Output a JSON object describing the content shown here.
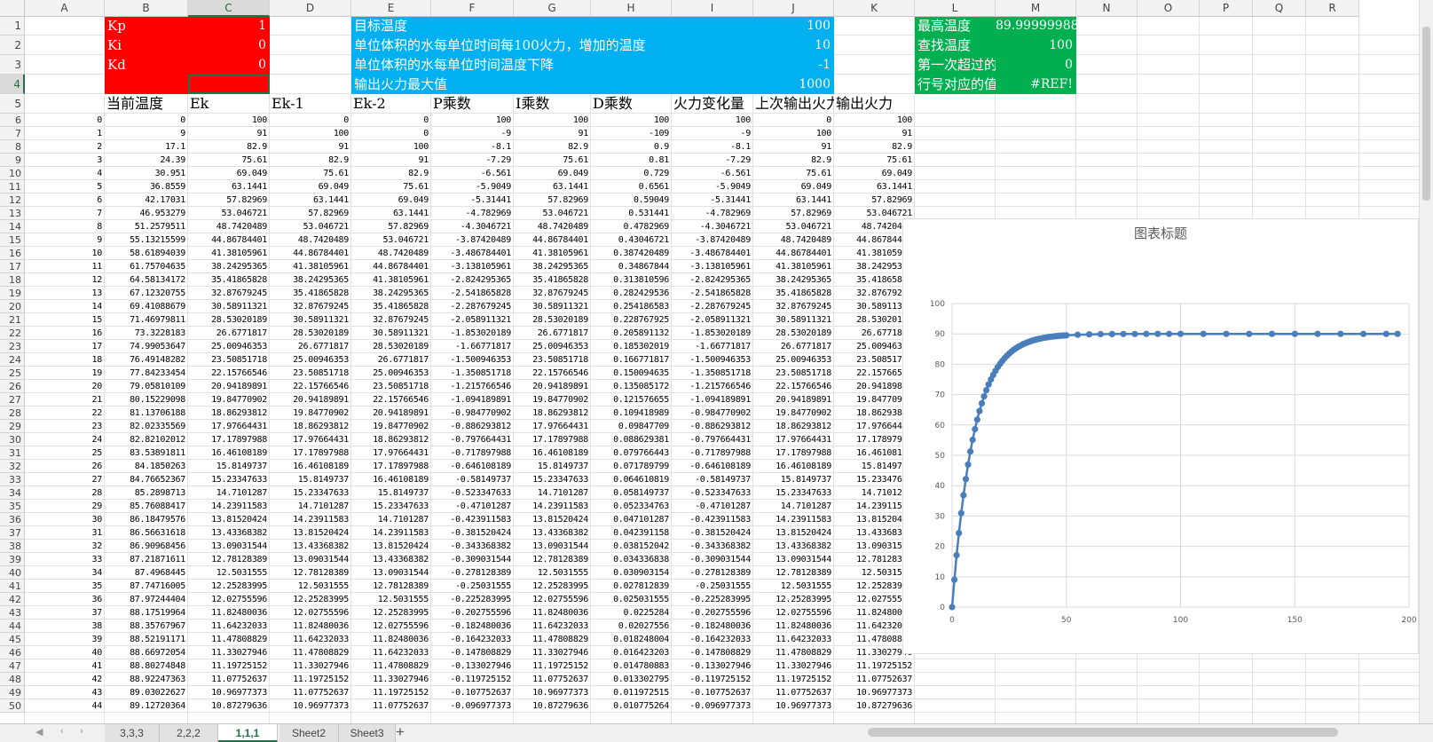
{
  "columns": [
    "A",
    "B",
    "C",
    "D",
    "E",
    "F",
    "G",
    "H",
    "I",
    "J",
    "K",
    "L",
    "M",
    "N",
    "O",
    "P",
    "Q",
    "R"
  ],
  "selected_column": "C",
  "selected_row": 4,
  "params": [
    {
      "label": "Kp",
      "value": "1"
    },
    {
      "label": "Ki",
      "value": "0"
    },
    {
      "label": "Kd",
      "value": "0"
    }
  ],
  "settings": [
    {
      "label": "目标温度",
      "value": "100"
    },
    {
      "label": "单位体积的水每单位时间每100火力，增加的温度",
      "value": "10"
    },
    {
      "label": "单位体积的水每单位时间温度下降",
      "value": "-1"
    },
    {
      "label": "输出火力最大值",
      "value": "1000"
    }
  ],
  "results": [
    {
      "label": "最高温度",
      "value": "89.99999988"
    },
    {
      "label": "查找温度",
      "value": "100"
    },
    {
      "label": "第一次超过的行号",
      "value": "0"
    },
    {
      "label": "行号对应的值",
      "value": "#REF!"
    }
  ],
  "headers": [
    "当前温度",
    "Ek",
    "Ek-1",
    "Ek-2",
    "P乘数",
    "I乘数",
    "D乘数",
    "火力变化量",
    "上次输出火力",
    "输出火力"
  ],
  "rows": [
    [
      "0",
      "0",
      "100",
      "0",
      "0",
      "100",
      "100",
      "100",
      "100",
      "0",
      "100"
    ],
    [
      "1",
      "9",
      "91",
      "100",
      "0",
      "-9",
      "91",
      "-109",
      "-9",
      "100",
      "91"
    ],
    [
      "2",
      "17.1",
      "82.9",
      "91",
      "100",
      "-8.1",
      "82.9",
      "0.9",
      "-8.1",
      "91",
      "82.9"
    ],
    [
      "3",
      "24.39",
      "75.61",
      "82.9",
      "91",
      "-7.29",
      "75.61",
      "0.81",
      "-7.29",
      "82.9",
      "75.61"
    ],
    [
      "4",
      "30.951",
      "69.049",
      "75.61",
      "82.9",
      "-6.561",
      "69.049",
      "0.729",
      "-6.561",
      "75.61",
      "69.049"
    ],
    [
      "5",
      "36.8559",
      "63.1441",
      "69.049",
      "75.61",
      "-5.9049",
      "63.1441",
      "0.6561",
      "-5.9049",
      "69.049",
      "63.1441"
    ],
    [
      "6",
      "42.17031",
      "57.82969",
      "63.1441",
      "69.049",
      "-5.31441",
      "57.82969",
      "0.59049",
      "-5.31441",
      "63.1441",
      "57.82969"
    ],
    [
      "7",
      "46.953279",
      "53.046721",
      "57.82969",
      "63.1441",
      "-4.782969",
      "53.046721",
      "0.531441",
      "-4.782969",
      "57.82969",
      "53.046721"
    ],
    [
      "8",
      "51.2579511",
      "48.7420489",
      "53.046721",
      "57.82969",
      "-4.3046721",
      "48.7420489",
      "0.4782969",
      "-4.3046721",
      "53.046721",
      "48.7420489"
    ],
    [
      "9",
      "55.13215599",
      "44.86784401",
      "48.7420489",
      "53.046721",
      "-3.87420489",
      "44.86784401",
      "0.43046721",
      "-3.87420489",
      "48.7420489",
      "44.86784401"
    ],
    [
      "10",
      "58.61894039",
      "41.38105961",
      "44.86784401",
      "48.7420489",
      "-3.486784401",
      "41.38105961",
      "0.387420489",
      "-3.486784401",
      "44.86784401",
      "41.38105961"
    ],
    [
      "11",
      "61.75704635",
      "38.24295365",
      "41.38105961",
      "44.86784401",
      "-3.138105961",
      "38.24295365",
      "0.34867844",
      "-3.138105961",
      "41.38105961",
      "38.24295365"
    ],
    [
      "12",
      "64.58134172",
      "35.41865828",
      "38.24295365",
      "41.38105961",
      "-2.824295365",
      "35.41865828",
      "0.313810596",
      "-2.824295365",
      "38.24295365",
      "35.41865828"
    ],
    [
      "13",
      "67.12320755",
      "32.87679245",
      "35.41865828",
      "38.24295365",
      "-2.541865828",
      "32.87679245",
      "0.282429536",
      "-2.541865828",
      "35.41865828",
      "32.87679245"
    ],
    [
      "14",
      "69.41088679",
      "30.58911321",
      "32.87679245",
      "35.41865828",
      "-2.287679245",
      "30.58911321",
      "0.254186583",
      "-2.287679245",
      "32.87679245",
      "30.58911321"
    ],
    [
      "15",
      "71.46979811",
      "28.53020189",
      "30.58911321",
      "32.87679245",
      "-2.058911321",
      "28.53020189",
      "0.228767925",
      "-2.058911321",
      "30.58911321",
      "28.53020189"
    ],
    [
      "16",
      "73.3228183",
      "26.6771817",
      "28.53020189",
      "30.58911321",
      "-1.853020189",
      "26.6771817",
      "0.205891132",
      "-1.853020189",
      "28.53020189",
      "26.6771817"
    ],
    [
      "17",
      "74.99053647",
      "25.00946353",
      "26.6771817",
      "28.53020189",
      "-1.66771817",
      "25.00946353",
      "0.185302019",
      "-1.66771817",
      "26.6771817",
      "25.00946353"
    ],
    [
      "18",
      "76.49148282",
      "23.50851718",
      "25.00946353",
      "26.6771817",
      "-1.500946353",
      "23.50851718",
      "0.166771817",
      "-1.500946353",
      "25.00946353",
      "23.50851718"
    ],
    [
      "19",
      "77.84233454",
      "22.15766546",
      "23.50851718",
      "25.00946353",
      "-1.350851718",
      "22.15766546",
      "0.150094635",
      "-1.350851718",
      "23.50851718",
      "22.15766546"
    ],
    [
      "20",
      "79.05810109",
      "20.94189891",
      "22.15766546",
      "23.50851718",
      "-1.215766546",
      "20.94189891",
      "0.135085172",
      "-1.215766546",
      "22.15766546",
      "20.94189891"
    ],
    [
      "21",
      "80.15229098",
      "19.84770902",
      "20.94189891",
      "22.15766546",
      "-1.094189891",
      "19.84770902",
      "0.121576655",
      "-1.094189891",
      "20.94189891",
      "19.84770902"
    ],
    [
      "22",
      "81.13706188",
      "18.86293812",
      "19.84770902",
      "20.94189891",
      "-0.984770902",
      "18.86293812",
      "0.109418989",
      "-0.984770902",
      "19.84770902",
      "18.86293812"
    ],
    [
      "23",
      "82.02335569",
      "17.97664431",
      "18.86293812",
      "19.84770902",
      "-0.886293812",
      "17.97664431",
      "0.09847709",
      "-0.886293812",
      "18.86293812",
      "17.97664431"
    ],
    [
      "24",
      "82.82102012",
      "17.17897988",
      "17.97664431",
      "18.86293812",
      "-0.797664431",
      "17.17897988",
      "0.088629381",
      "-0.797664431",
      "17.97664431",
      "17.17897988"
    ],
    [
      "25",
      "83.53891811",
      "16.46108189",
      "17.17897988",
      "17.97664431",
      "-0.717897988",
      "16.46108189",
      "0.079766443",
      "-0.717897988",
      "17.17897988",
      "16.46108189"
    ],
    [
      "26",
      "84.1850263",
      "15.8149737",
      "16.46108189",
      "17.17897988",
      "-0.646108189",
      "15.8149737",
      "0.071789799",
      "-0.646108189",
      "16.46108189",
      "15.8149737"
    ],
    [
      "27",
      "84.76652367",
      "15.23347633",
      "15.8149737",
      "16.46108189",
      "-0.58149737",
      "15.23347633",
      "0.064610819",
      "-0.58149737",
      "15.8149737",
      "15.23347633"
    ],
    [
      "28",
      "85.2898713",
      "14.7101287",
      "15.23347633",
      "15.8149737",
      "-0.523347633",
      "14.7101287",
      "0.058149737",
      "-0.523347633",
      "15.23347633",
      "14.7101287"
    ],
    [
      "29",
      "85.76088417",
      "14.23911583",
      "14.7101287",
      "15.23347633",
      "-0.47101287",
      "14.23911583",
      "0.052334763",
      "-0.47101287",
      "14.7101287",
      "14.23911583"
    ],
    [
      "30",
      "86.18479576",
      "13.81520424",
      "14.23911583",
      "14.7101287",
      "-0.423911583",
      "13.81520424",
      "0.047101287",
      "-0.423911583",
      "14.23911583",
      "13.81520424"
    ],
    [
      "31",
      "86.56631618",
      "13.43368382",
      "13.81520424",
      "14.23911583",
      "-0.381520424",
      "13.43368382",
      "0.042391158",
      "-0.381520424",
      "13.81520424",
      "13.43368382"
    ],
    [
      "32",
      "86.90968456",
      "13.09031544",
      "13.43368382",
      "13.81520424",
      "-0.343368382",
      "13.09031544",
      "0.038152042",
      "-0.343368382",
      "13.43368382",
      "13.09031544"
    ],
    [
      "33",
      "87.21871611",
      "12.78128389",
      "13.09031544",
      "13.43368382",
      "-0.309031544",
      "12.78128389",
      "0.034336838",
      "-0.309031544",
      "13.09031544",
      "12.78128389"
    ],
    [
      "34",
      "87.4968445",
      "12.5031555",
      "12.78128389",
      "13.09031544",
      "-0.278128389",
      "12.5031555",
      "0.030903154",
      "-0.278128389",
      "12.78128389",
      "12.5031555"
    ],
    [
      "35",
      "87.74716005",
      "12.25283995",
      "12.5031555",
      "12.78128389",
      "-0.25031555",
      "12.25283995",
      "0.027812839",
      "-0.25031555",
      "12.5031555",
      "12.25283995"
    ],
    [
      "36",
      "87.97244404",
      "12.02755596",
      "12.25283995",
      "12.5031555",
      "-0.225283995",
      "12.02755596",
      "0.025031555",
      "-0.225283995",
      "12.25283995",
      "12.02755596"
    ],
    [
      "37",
      "88.17519964",
      "11.82480036",
      "12.02755596",
      "12.25283995",
      "-0.202755596",
      "11.82480036",
      "0.0225284",
      "-0.202755596",
      "12.02755596",
      "11.82480036"
    ],
    [
      "38",
      "88.35767967",
      "11.64232033",
      "11.82480036",
      "12.02755596",
      "-0.182480036",
      "11.64232033",
      "0.02027556",
      "-0.182480036",
      "11.82480036",
      "11.64232033"
    ],
    [
      "39",
      "88.52191171",
      "11.47808829",
      "11.64232033",
      "11.82480036",
      "-0.164232033",
      "11.47808829",
      "0.018248004",
      "-0.164232033",
      "11.64232033",
      "11.47808829"
    ],
    [
      "40",
      "88.66972054",
      "11.33027946",
      "11.47808829",
      "11.64232033",
      "-0.147808829",
      "11.33027946",
      "0.016423203",
      "-0.147808829",
      "11.47808829",
      "11.33027946"
    ],
    [
      "41",
      "88.80274848",
      "11.19725152",
      "11.33027946",
      "11.47808829",
      "-0.133027946",
      "11.19725152",
      "0.014780883",
      "-0.133027946",
      "11.33027946",
      "11.19725152"
    ],
    [
      "42",
      "88.92247363",
      "11.07752637",
      "11.19725152",
      "11.33027946",
      "-0.119725152",
      "11.07752637",
      "0.013302795",
      "-0.119725152",
      "11.19725152",
      "11.07752637"
    ],
    [
      "43",
      "89.03022627",
      "10.96977373",
      "11.07752637",
      "11.19725152",
      "-0.107752637",
      "10.96977373",
      "0.011972515",
      "-0.107752637",
      "11.07752637",
      "10.96977373"
    ],
    [
      "44",
      "89.12720364",
      "10.87279636",
      "10.96977373",
      "11.07752637",
      "-0.096977373",
      "10.87279636",
      "0.010775264",
      "-0.096977373",
      "10.96977373",
      "10.87279636"
    ]
  ],
  "colors": {
    "red": "#ff0000",
    "blue": "#00b0f0",
    "green": "#00b050",
    "series": "#4a7ebb",
    "accent": "#217346"
  },
  "chart_data": {
    "type": "scatter",
    "title": "图表标题",
    "xlim": [
      0,
      200
    ],
    "ylim": [
      0,
      100
    ],
    "xticks": [
      "0",
      "50",
      "100",
      "150",
      "200"
    ],
    "yticks": [
      "0",
      "10",
      "20",
      "30",
      "40",
      "50",
      "60",
      "70",
      "80",
      "90",
      "100"
    ],
    "grid": true,
    "series": [
      {
        "x": [
          0,
          1,
          2,
          3,
          4,
          5,
          6,
          7,
          8,
          9,
          10,
          11,
          12,
          13,
          14,
          15,
          16,
          17,
          18,
          19,
          20,
          21,
          22,
          23,
          24,
          25,
          26,
          27,
          28,
          29,
          30,
          31,
          32,
          33,
          34,
          35,
          36,
          37,
          38,
          39,
          40,
          41,
          42,
          43,
          44,
          45,
          46,
          47,
          48,
          49,
          50,
          55,
          60,
          65,
          70,
          75,
          80,
          85,
          90,
          95,
          100,
          110,
          120,
          130,
          140,
          150,
          160,
          170,
          180,
          190,
          195
        ],
        "y": [
          0,
          9,
          17.1,
          24.39,
          30.95,
          36.86,
          42.17,
          46.95,
          51.26,
          55.13,
          58.62,
          61.76,
          64.58,
          67.12,
          69.41,
          71.47,
          73.32,
          74.99,
          76.49,
          77.84,
          79.06,
          80.15,
          81.14,
          82.02,
          82.82,
          83.54,
          84.19,
          84.77,
          85.29,
          85.76,
          86.18,
          86.57,
          86.91,
          87.22,
          87.5,
          87.75,
          87.97,
          88.18,
          88.36,
          88.52,
          88.67,
          88.8,
          88.92,
          89.03,
          89.13,
          89.22,
          89.29,
          89.36,
          89.43,
          89.48,
          89.54,
          89.72,
          89.84,
          89.9,
          89.94,
          89.96,
          89.98,
          89.99,
          89.99,
          90.0,
          90.0,
          90.0,
          90.0,
          90.0,
          90.0,
          90.0,
          90.0,
          90.0,
          90.0,
          90.0,
          90.0
        ]
      }
    ]
  },
  "sheet_tabs": [
    "3,3,3",
    "2,2,2",
    "1,1,1",
    "Sheet2",
    "Sheet3"
  ],
  "active_tab": "1,1,1",
  "add_sheet_label": "+"
}
